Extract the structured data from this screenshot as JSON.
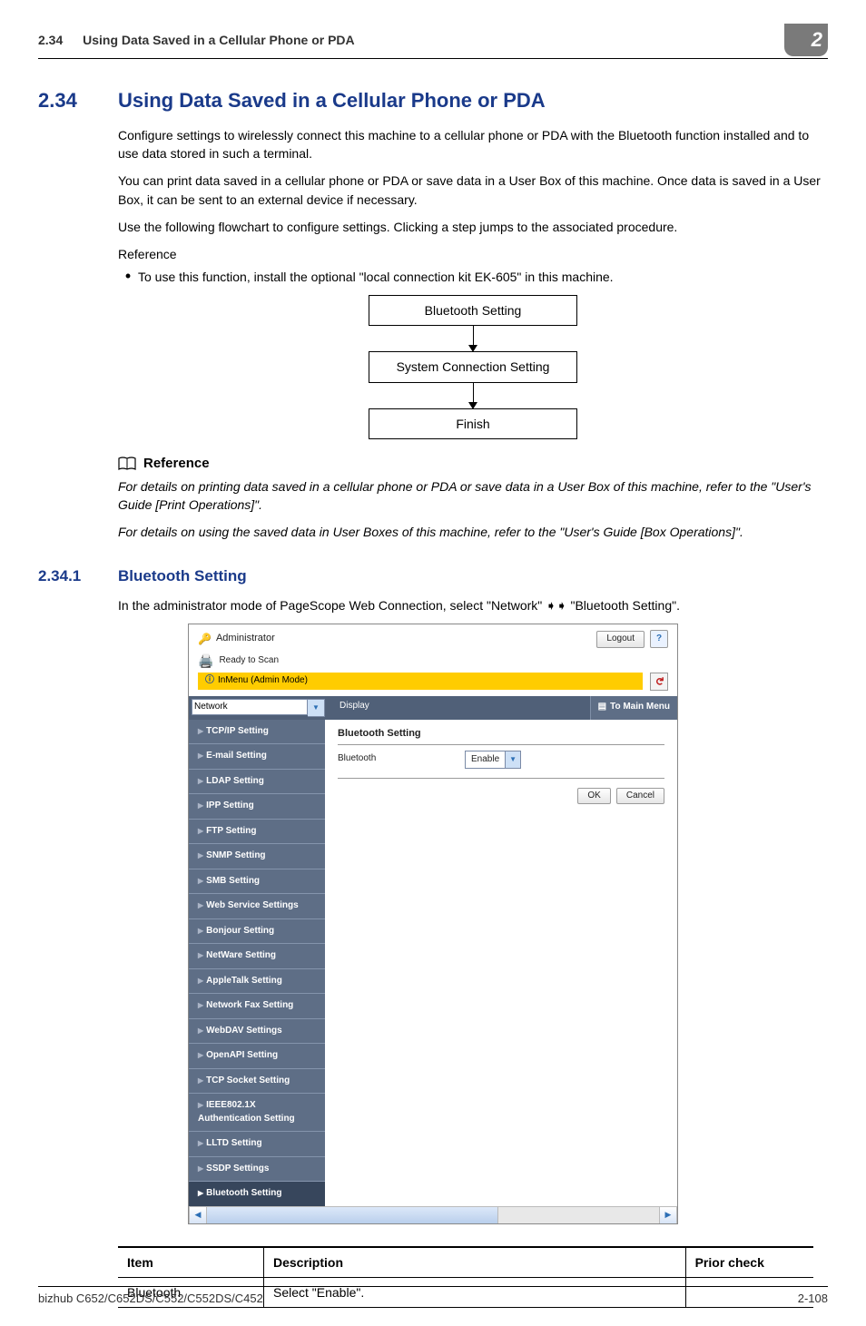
{
  "header": {
    "section_number": "2.34",
    "section_title_running": "Using Data Saved in a Cellular Phone or PDA",
    "chapter_number": "2"
  },
  "section": {
    "number": "2.34",
    "title": "Using Data Saved in a Cellular Phone or PDA",
    "paragraphs": [
      "Configure settings to wirelessly connect this machine to a cellular phone or PDA with the Bluetooth function installed and to use data stored in such a terminal.",
      "You can print data saved in a cellular phone or PDA or save data in a User Box of this machine. Once data is saved in a User Box, it can be sent to an external device if necessary.",
      "Use the following flowchart to configure settings. Clicking a step jumps to the associated procedure."
    ],
    "reference_label": "Reference",
    "reference_bullet": "To use this function, install the optional \"local connection kit EK-605\" in this machine."
  },
  "flowchart": {
    "steps": [
      "Bluetooth Setting",
      "System Connection Setting",
      "Finish"
    ]
  },
  "d_reference": {
    "label": "Reference",
    "text1": "For details on printing data saved in a cellular phone or PDA or save data in a User Box of this machine, refer to the \"User's Guide [Print Operations]\".",
    "text2": "For details on using the saved data in User Boxes of this machine, refer to the \"User's Guide [Box Operations]\"."
  },
  "subsection": {
    "number": "2.34.1",
    "title": "Bluetooth Setting",
    "intro": "In the administrator mode of PageScope Web Connection, select \"Network\" ➧➧ \"Bluetooth Setting\"."
  },
  "screenshot": {
    "admin_label": "Administrator",
    "logout": "Logout",
    "help": "?",
    "ready": "Ready to Scan",
    "mode": "InMenu (Admin Mode)",
    "select_value": "Network",
    "display_label": "Display",
    "to_main_menu": "To Main Menu",
    "sidebar": [
      "TCP/IP Setting",
      "E-mail Setting",
      "LDAP Setting",
      "IPP Setting",
      "FTP Setting",
      "SNMP Setting",
      "SMB Setting",
      "Web Service Settings",
      "Bonjour Setting",
      "NetWare Setting",
      "AppleTalk Setting",
      "Network Fax Setting",
      "WebDAV Settings",
      "OpenAPI Setting",
      "TCP Socket Setting",
      "IEEE802.1X Authentication Setting",
      "LLTD Setting",
      "SSDP Settings",
      "Bluetooth Setting"
    ],
    "main_title": "Bluetooth Setting",
    "row_label": "Bluetooth",
    "row_value": "Enable",
    "ok": "OK",
    "cancel": "Cancel"
  },
  "desc_table": {
    "head": [
      "Item",
      "Description",
      "Prior check"
    ],
    "row": [
      "Bluetooth",
      "Select \"Enable\".",
      ""
    ]
  },
  "footer": {
    "model": "bizhub C652/C652DS/C552/C552DS/C452",
    "page": "2-108"
  }
}
